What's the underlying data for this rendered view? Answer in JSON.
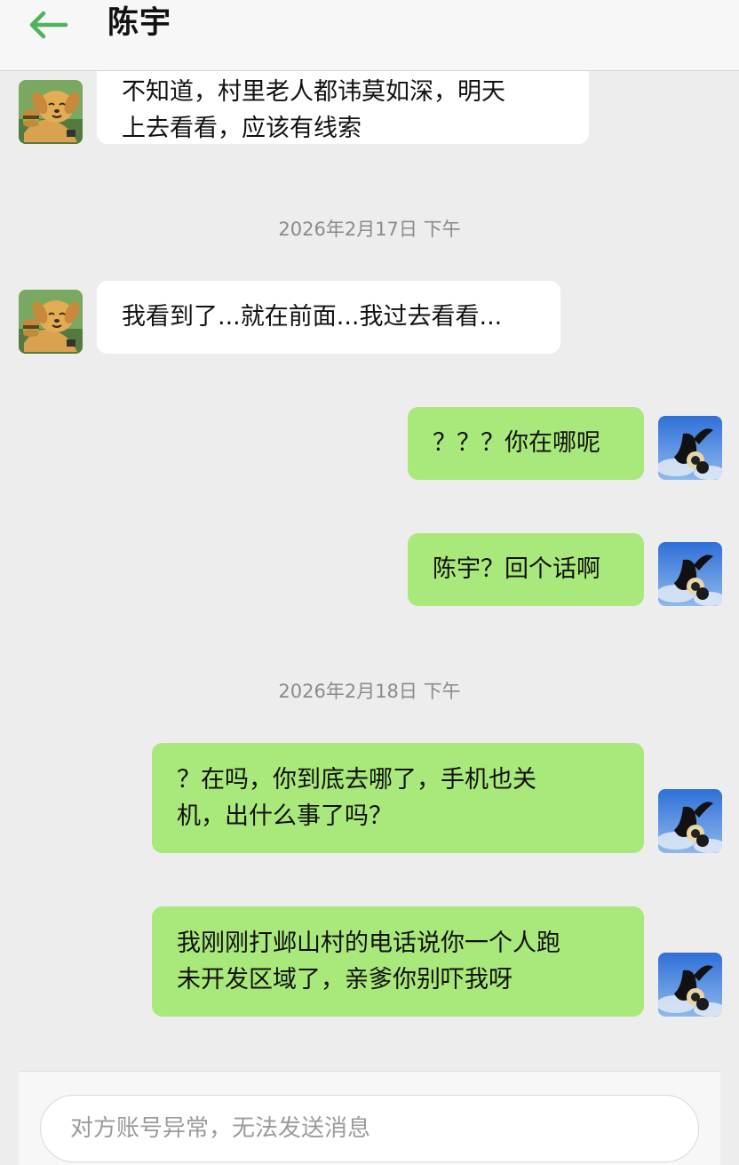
{
  "header": {
    "title": "陈宇",
    "back_icon": "arrow-left-icon",
    "accent_color": "#4cb55a"
  },
  "messages": [
    {
      "type": "in",
      "text": "不知道，村里老人都讳莫如深，明天\n上去看看，应该有线索"
    },
    {
      "type": "timestamp",
      "text": "2026年2月17日 下午"
    },
    {
      "type": "in",
      "text": "我看到了...就在前面...我过去看看..."
    },
    {
      "type": "out",
      "text": "？？？你在哪呢"
    },
    {
      "type": "out",
      "text": "陈宇？回个话啊"
    },
    {
      "type": "timestamp",
      "text": "2026年2月18日 下午"
    },
    {
      "type": "out",
      "text": "？在吗，你到底去哪了，手机也关\n机，出什么事了吗？"
    },
    {
      "type": "out",
      "text": "我刚刚打邺山村的电话说你一个人跑\n未开发区域了，亲爹你别吓我呀"
    }
  ],
  "input": {
    "placeholder": "对方账号异常，无法发送消息"
  },
  "colors": {
    "background": "#ededed",
    "incoming_bubble": "#ffffff",
    "outgoing_bubble": "#a9e87a",
    "timestamp_text": "#8a8a8a"
  },
  "icons": {
    "contact_avatar": "dog-avatar-icon",
    "self_avatar": "sky-avatar-icon"
  }
}
